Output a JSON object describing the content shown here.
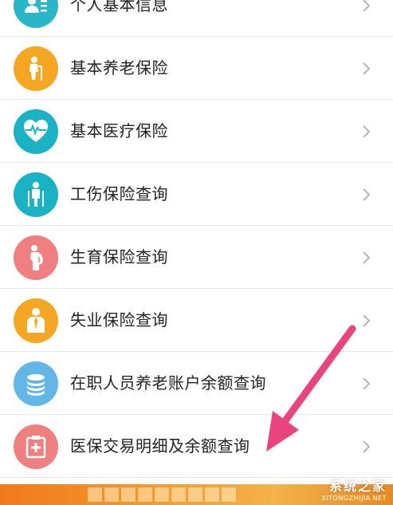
{
  "menu": {
    "items": [
      {
        "label": "个人基本信息",
        "icon": "person-card-icon",
        "color": "#29b6c8"
      },
      {
        "label": "基本养老保险",
        "icon": "elderly-person-icon",
        "color": "#f5a623"
      },
      {
        "label": "基本医疗保险",
        "icon": "heart-pulse-icon",
        "color": "#1ab3c6"
      },
      {
        "label": "工伤保险查询",
        "icon": "injured-person-icon",
        "color": "#1ab3c6"
      },
      {
        "label": "生育保险查询",
        "icon": "pregnant-woman-icon",
        "color": "#f08080"
      },
      {
        "label": "失业保险查询",
        "icon": "worker-icon",
        "color": "#f5a623"
      },
      {
        "label": "在职人员养老账户余额查询",
        "icon": "coin-stack-icon",
        "color": "#62b7e8"
      },
      {
        "label": "医保交易明细及余额查询",
        "icon": "medical-kit-icon",
        "color": "#f08080"
      }
    ]
  },
  "annotation": {
    "arrow_color": "#e8457f"
  },
  "footer": {
    "color": "#f28a22"
  },
  "watermark": {
    "main": "系统之家",
    "sub": "XITONGZHIJIA.NET"
  }
}
